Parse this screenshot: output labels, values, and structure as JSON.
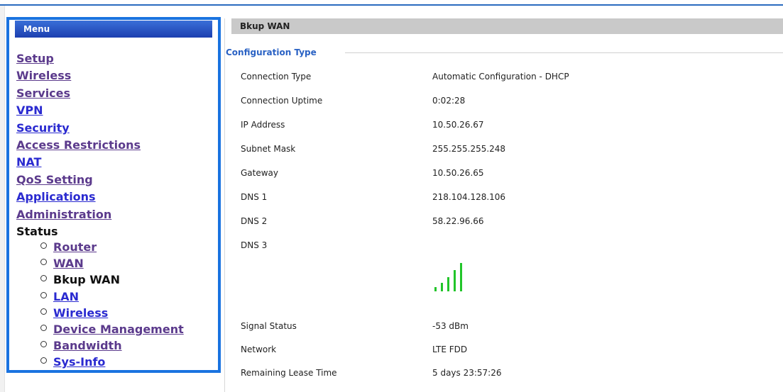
{
  "menu": {
    "title": "Menu",
    "items": [
      {
        "label": "Setup",
        "visited": true
      },
      {
        "label": "Wireless",
        "visited": true
      },
      {
        "label": "Services",
        "visited": true
      },
      {
        "label": "VPN",
        "visited": false
      },
      {
        "label": "Security",
        "visited": false
      },
      {
        "label": "Access Restrictions",
        "visited": true
      },
      {
        "label": "NAT",
        "visited": false
      },
      {
        "label": "QoS Setting",
        "visited": true
      },
      {
        "label": "Applications",
        "visited": false
      },
      {
        "label": "Administration",
        "visited": true
      },
      {
        "label": "Status",
        "current": true
      }
    ],
    "status_submenu": [
      {
        "label": "Router",
        "visited": true
      },
      {
        "label": "WAN",
        "visited": true
      },
      {
        "label": "Bkup WAN",
        "current": true
      },
      {
        "label": "LAN",
        "visited": false
      },
      {
        "label": "Wireless",
        "visited": false
      },
      {
        "label": "Device Management",
        "visited": true
      },
      {
        "label": "Bandwidth",
        "visited": true
      },
      {
        "label": "Sys-Info",
        "visited": false
      }
    ]
  },
  "section": {
    "title": "Bkup WAN",
    "legend": "Configuration Type"
  },
  "rows": [
    {
      "label": "Connection Type",
      "value": "Automatic Configuration - DHCP"
    },
    {
      "label": "Connection Uptime",
      "value": "0:02:28"
    },
    {
      "label": "IP Address",
      "value": "10.50.26.67"
    },
    {
      "label": "Subnet Mask",
      "value": "255.255.255.248"
    },
    {
      "label": "Gateway",
      "value": "10.50.26.65"
    },
    {
      "label": "DNS 1",
      "value": "218.104.128.106"
    },
    {
      "label": "DNS 2",
      "value": "58.22.96.66"
    },
    {
      "label": "DNS 3",
      "value": ""
    },
    {
      "label": "Signal Status",
      "value": "-53 dBm"
    },
    {
      "label": "Network",
      "value": "LTE FDD"
    },
    {
      "label": "Remaining Lease Time",
      "value": "5 days 23:57:26"
    }
  ],
  "signal_icon": {
    "name": "signal-strength-icon",
    "level": 5,
    "max": 5,
    "color": "#22c52a"
  },
  "colors": {
    "link": "#2a2ad0",
    "visited_link": "#5b3a8c",
    "accent": "#1a73e0",
    "legend": "#2a62c4"
  }
}
